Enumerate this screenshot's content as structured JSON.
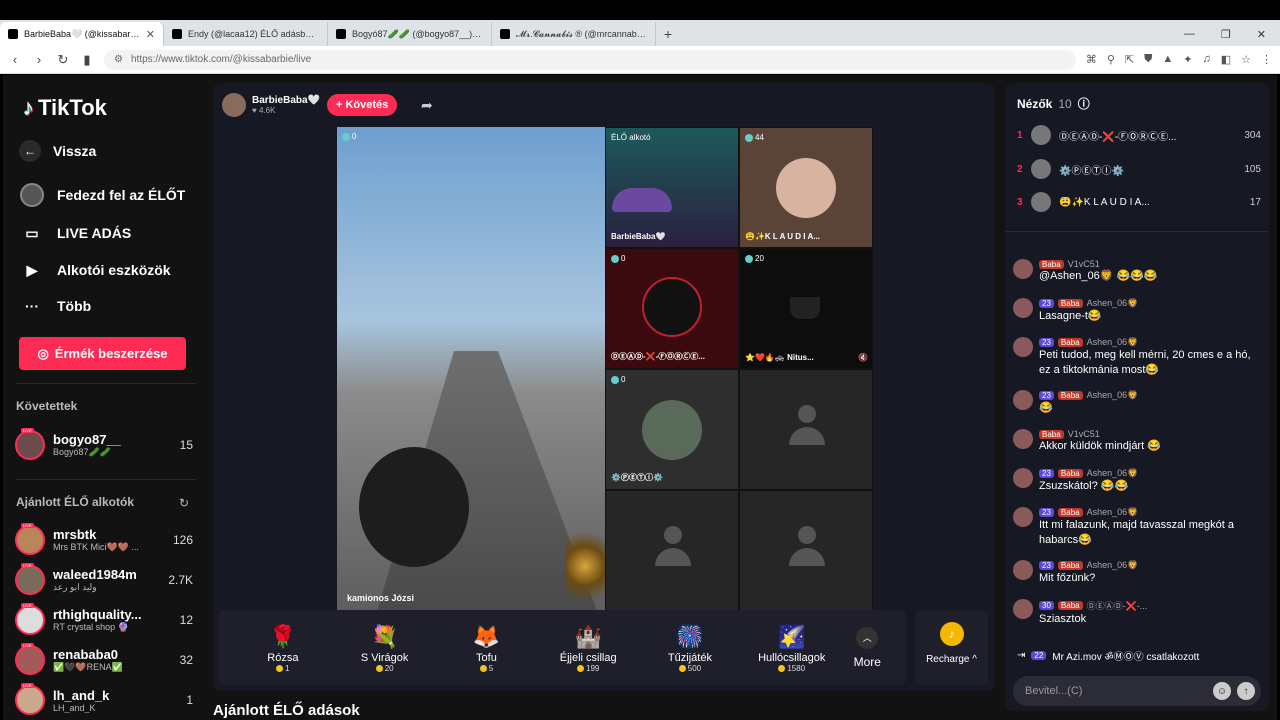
{
  "browser": {
    "tabs": [
      {
        "title": "BarbieBaba🤍 (@kissabarbie) ..."
      },
      {
        "title": "Endy (@lacaa12) ÉLŐ adásban van –"
      },
      {
        "title": "Bogyó87🥒🥒 (@bogyo87__) ÉLŐ a"
      },
      {
        "title": "𝓜𝓻.𝓒𝓪𝓷𝓷𝓪𝓫𝓲𝓼 ® (@mrcannabis_)"
      }
    ],
    "url": "https://www.tiktok.com/@kissabarbie/live"
  },
  "sidebar": {
    "brand": "TikTok",
    "back": "Vissza",
    "nav": [
      "Fedezd fel az ÉLŐT",
      "LIVE ADÁS",
      "Alkotói eszközök",
      "Több"
    ],
    "coins_button": "Érmék beszerzése",
    "following_title": "Követettek",
    "following": [
      {
        "name": "bogyo87__",
        "sub": "Bogyó87🥒🥒",
        "count": "15"
      }
    ],
    "recommended_title": "Ajánlott ÉLŐ alkotók",
    "recommended": [
      {
        "name": "mrsbtk",
        "sub": "Mrs BTK Mici🤎🤎 ...",
        "count": "126"
      },
      {
        "name": "waleed1984m",
        "sub": "وليد ابو رعد",
        "count": "2.7K"
      },
      {
        "name": "rthighquality...",
        "sub": "RT crystal shop 🔮",
        "count": "12"
      },
      {
        "name": "renababa0",
        "sub": "✅🖤🤎RENA✅",
        "count": "32"
      },
      {
        "name": "lh_and_k",
        "sub": "LH_and_K",
        "count": "1"
      }
    ]
  },
  "stream": {
    "host_name": "BarbieBaba🤍",
    "host_likes": "4.6K",
    "follow": "+ Követés",
    "main_label": "kamionos Józsi",
    "tiles": [
      {
        "count": "0",
        "label": "",
        "badge": ""
      },
      {
        "count": "",
        "label": "BarbieBaba🤍",
        "badge": "ÉLŐ alkotó"
      },
      {
        "count": "44",
        "label": "😩✨K L A U D I A..."
      },
      {
        "count": "0",
        "label": "ⒹⒺⒶⒹ-❌-ⒻⓄⓇⒸⒺ..."
      },
      {
        "count": "20",
        "label": "⭐❤️🔥🚓 Nitus..."
      },
      {
        "count": "0",
        "label": "⚙️ⓅⒺⓉⒾ⚙️"
      }
    ],
    "gifts": [
      {
        "icon": "🌹",
        "name": "Rózsa",
        "price": "1"
      },
      {
        "icon": "💐",
        "name": "S Virágok",
        "price": "20"
      },
      {
        "icon": "🦊",
        "name": "Tofu",
        "price": "5"
      },
      {
        "icon": "🏰",
        "name": "Éjjeli csillag",
        "price": "199"
      },
      {
        "icon": "🎆",
        "name": "Tűzijáték",
        "price": "500"
      },
      {
        "icon": "🌠",
        "name": "Hullócsillagok",
        "price": "1580"
      }
    ],
    "more": "More",
    "recharge": "Recharge"
  },
  "recommended_live_title": "Ajánlott ÉLŐ adások",
  "chat": {
    "viewers_title": "Nézők",
    "viewers_count": "10",
    "top_viewers": [
      {
        "rank": "1",
        "name": "ⒹⒺⒶⒹ-❌-ⒻⓄⓇⒸⒺ...",
        "points": "304"
      },
      {
        "rank": "2",
        "name": "⚙️ⓅⒺⓉⒾ⚙️",
        "points": "105"
      },
      {
        "rank": "3",
        "name": "😩✨K L A U D I A...",
        "points": "17"
      }
    ],
    "messages": [
      {
        "user": "V1vC51",
        "level": "",
        "fan": "Baba",
        "text": "@Ashen_06🦁 😂😂😂"
      },
      {
        "user": "Ashen_06🦁",
        "level": "23",
        "fan": "Baba",
        "text": "Lasagne-t😂"
      },
      {
        "user": "Ashen_06🦁",
        "level": "23",
        "fan": "Baba",
        "text": "Peti tudod, meg kell mérni, 20 cmes e a hó, ez a tiktokmánia most😂"
      },
      {
        "user": "Ashen_06🦁",
        "level": "23",
        "fan": "Baba",
        "text": "😂"
      },
      {
        "user": "V1vC51",
        "level": "",
        "fan": "Baba",
        "text": "Akkor küldök mindjárt 😂"
      },
      {
        "user": "Ashen_06🦁",
        "level": "23",
        "fan": "Baba",
        "text": "Zsuzskátol? 😂😂"
      },
      {
        "user": "Ashen_06🦁",
        "level": "23",
        "fan": "Baba",
        "text": "Itt mi falazunk, majd tavasszal megkót a habarcs😂"
      },
      {
        "user": "Ashen_06🦁",
        "level": "23",
        "fan": "Baba",
        "text": "Mit főzünk?"
      },
      {
        "user": "ⒹⒺⒶⒹ-❌-...",
        "level": "30",
        "fan": "Baba",
        "text": "Sziasztok"
      }
    ],
    "joined": "Mr Azi.mov ॐⓂⓄⓋ csatlakozott",
    "joined_level": "22",
    "input_placeholder": "Bevitel...(C)"
  }
}
